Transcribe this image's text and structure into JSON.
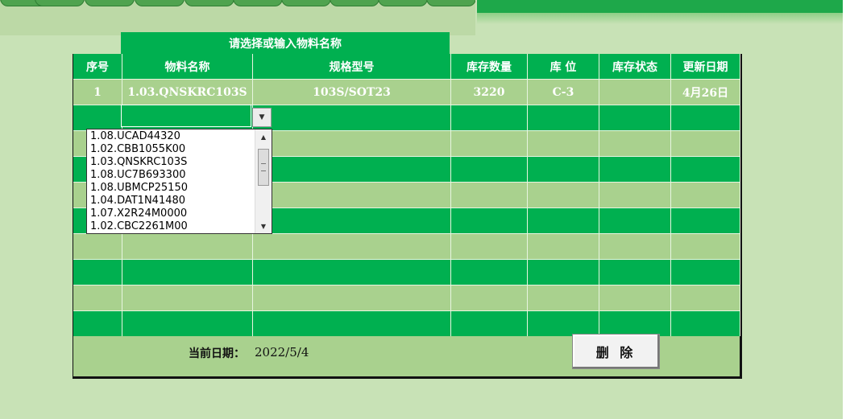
{
  "selector": {
    "header": "请选择或输入物料名称"
  },
  "table": {
    "headers": [
      "序号",
      "物料名称",
      "规格型号",
      "库存数量",
      "库 位",
      "库存状态",
      "更新日期"
    ],
    "rows": [
      [
        "1",
        "1.03.QNSKRC103S",
        "103S/SOT23",
        "3220",
        "C-3",
        "",
        "4月26日"
      ]
    ]
  },
  "combo": {
    "value": "",
    "options": [
      "1.08.UCAD44320",
      "1.02.CBB1055K00",
      "1.03.QNSKRC103S",
      "1.08.UC7B693300",
      "1.08.UBMCP25150",
      "1.04.DAT1N41480",
      "1.07.X2R24M0000",
      "1.02.CBC2261M00"
    ]
  },
  "footer": {
    "date_label": "当前日期：",
    "date_value": "2022/5/4",
    "delete_label": "删 除"
  },
  "colors": {
    "accent": "#00b050",
    "light_row": "#a9d18e",
    "background": "#c8e2b6"
  }
}
